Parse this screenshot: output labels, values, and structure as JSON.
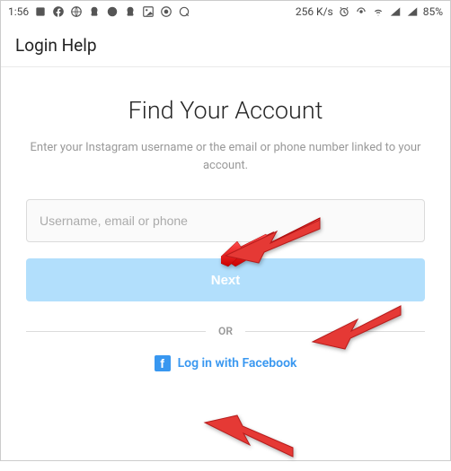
{
  "status_bar": {
    "time": "1:56",
    "network_speed": "256 K/s",
    "battery": "85%"
  },
  "header": {
    "title": "Login Help"
  },
  "main": {
    "title": "Find Your Account",
    "subtitle": "Enter your Instagram username or the email or phone number linked to your account.",
    "input_placeholder": "Username, email or phone",
    "input_value": "",
    "next_label": "Next",
    "divider_label": "OR",
    "fb_login_label": "Log in with Facebook"
  }
}
